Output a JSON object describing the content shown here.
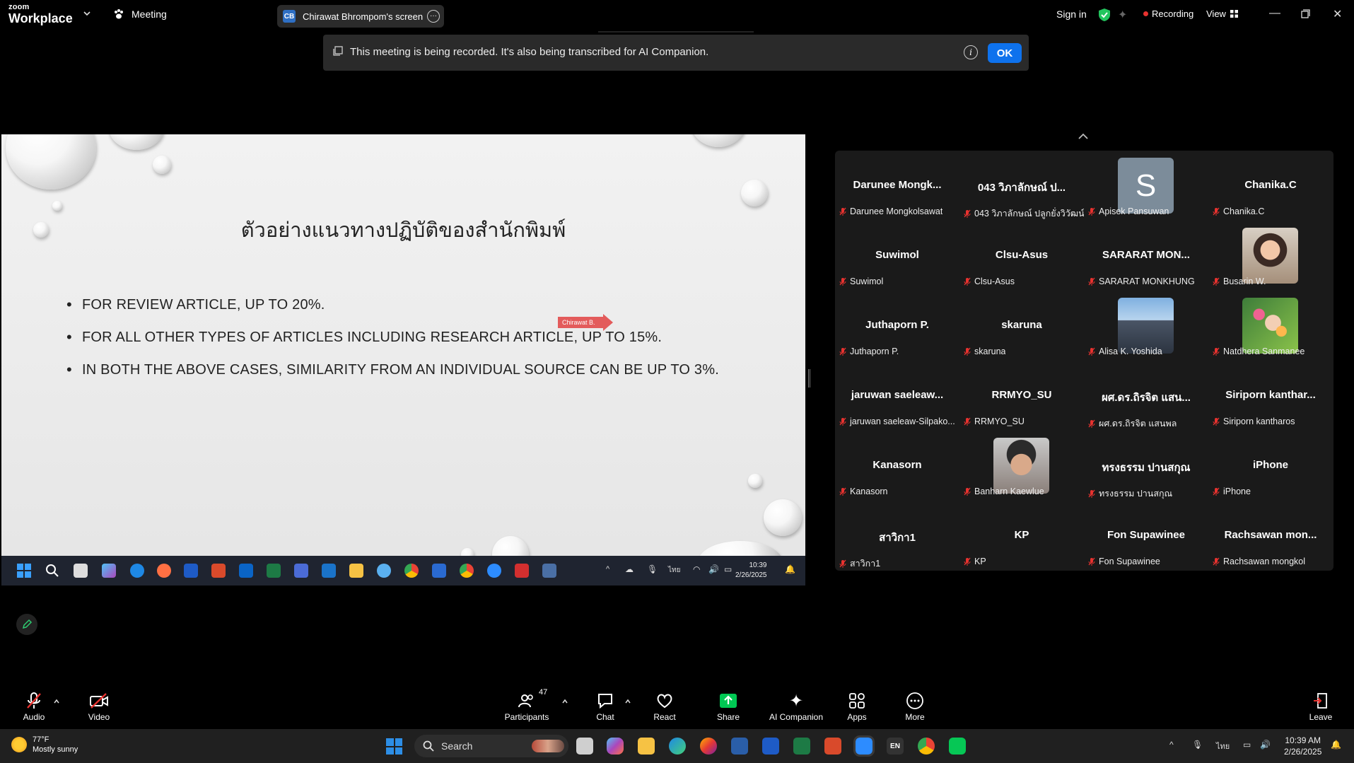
{
  "topbar": {
    "app_name_small": "zoom",
    "app_name": "Workplace",
    "meeting_label": "Meeting",
    "screen_pill": {
      "initials": "CB",
      "label": "Chirawat Bhrompom's screen"
    },
    "signin_label": "Sign in",
    "recording_label": "Recording",
    "view_label": "View"
  },
  "notice": {
    "message": "This meeting is being recorded. It's also being transcribed for AI Companion.",
    "ok_label": "OK"
  },
  "slide": {
    "title": "ตัวอย่างแนวทางปฏิบัติของสำนักพิมพ์",
    "bullets": [
      "FOR REVIEW ARTICLE, UP TO 20%.",
      "FOR ALL OTHER TYPES OF ARTICLES INCLUDING RESEARCH ARTICLE, UP TO 15%.",
      "IN BOTH THE ABOVE CASES, SIMILARITY FROM AN INDIVIDUAL SOURCE CAN BE UP TO 3%."
    ],
    "pointer_label": "Chirawat B."
  },
  "shared_taskbar": {
    "time": "10:39",
    "date": "2/26/2025",
    "lang": "ไทย"
  },
  "gallery": {
    "tiles": [
      {
        "display": "Darunee  Mongk...",
        "name": "Darunee Mongkolsawat"
      },
      {
        "display": "043 วิภาลักษณ์ ป...",
        "name": "043 วิภาลักษณ์ ปลูกยั่งวิวัฒน์"
      },
      {
        "display": "",
        "avatar_letter": "S",
        "name": "Apisek Pansuwan"
      },
      {
        "display": "Chanika.C",
        "name": "Chanika.C"
      },
      {
        "display": "Suwimol",
        "name": "Suwimol"
      },
      {
        "display": "Clsu-Asus",
        "name": "Clsu-Asus"
      },
      {
        "display": "SARARAT  MON...",
        "name": "SARARAT MONKHUNG"
      },
      {
        "display": "",
        "photo": "woman",
        "name": "Busarin W."
      },
      {
        "display": "Juthaporn P.",
        "name": "Juthaporn P."
      },
      {
        "display": "skaruna",
        "name": "skaruna"
      },
      {
        "display": "",
        "photo": "building",
        "name": "Alisa K. Yoshida"
      },
      {
        "display": "",
        "photo": "flowers",
        "name": "Natdhera Sanmanee"
      },
      {
        "display": "jaruwan  saeleaw...",
        "name": "jaruwan saeleaw-Silpako..."
      },
      {
        "display": "RRMYO_SU",
        "name": "RRMYO_SU"
      },
      {
        "display": "ผศ.ดร.ถิรจิต แสน...",
        "name": "ผศ.ดร.ถิรจิต แสนพล"
      },
      {
        "display": "Siriporn  kanthar...",
        "name": "Siriporn kantharos"
      },
      {
        "display": "Kanasorn",
        "name": "Kanasorn"
      },
      {
        "display": "",
        "photo": "man",
        "name": "Banharn Kaewlue"
      },
      {
        "display": "ทรงธรรม ปานสกุณ",
        "name": "ทรงธรรม ปานสกุณ"
      },
      {
        "display": "iPhone",
        "name": "iPhone"
      },
      {
        "display": "สาวิกา1",
        "name": "สาวิกา1"
      },
      {
        "display": "KP",
        "name": "KP"
      },
      {
        "display": "Fon Supawinee",
        "name": "Fon Supawinee"
      },
      {
        "display": "Rachsawan  mon...",
        "name": "Rachsawan mongkol"
      }
    ]
  },
  "toolbar": {
    "audio": "Audio",
    "video": "Video",
    "participants": "Participants",
    "participants_count": "47",
    "chat": "Chat",
    "react": "React",
    "share": "Share",
    "ai_companion": "AI Companion",
    "apps": "Apps",
    "more": "More",
    "leave": "Leave"
  },
  "wintaskbar": {
    "weather_temp": "77°F",
    "weather_desc": "Mostly sunny",
    "search_placeholder": "Search",
    "lang_en": "EN",
    "lang_th": "ไทย",
    "time": "10:39 AM",
    "date": "2/26/2025"
  },
  "colors": {
    "accent": "#0e72ed",
    "recording": "#e8322f",
    "pointer": "#e35b5b",
    "share_green": "#00c853"
  }
}
